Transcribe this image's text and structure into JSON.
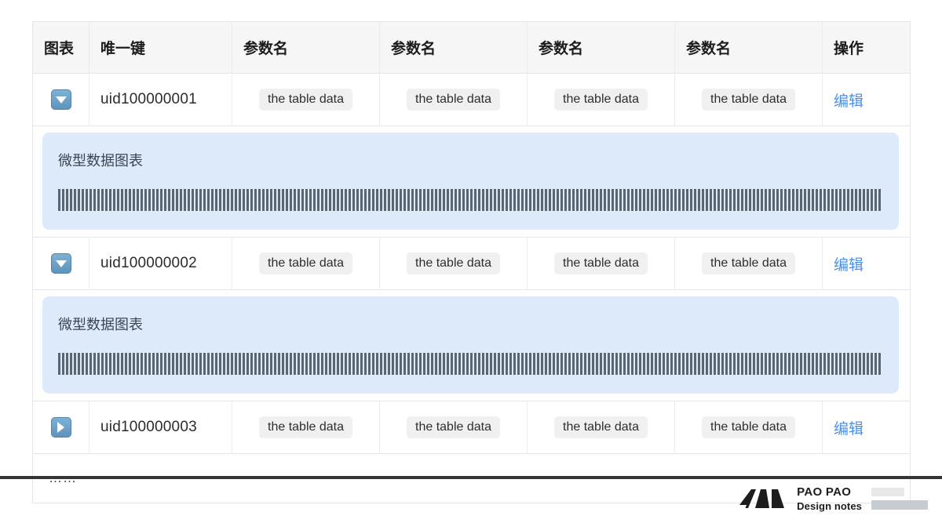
{
  "table": {
    "columns": [
      {
        "key": "chart",
        "label": "图表"
      },
      {
        "key": "uid",
        "label": "唯一键"
      },
      {
        "key": "p1",
        "label": "参数名"
      },
      {
        "key": "p2",
        "label": "参数名"
      },
      {
        "key": "p3",
        "label": "参数名"
      },
      {
        "key": "p4",
        "label": "参数名"
      },
      {
        "key": "op",
        "label": "操作"
      }
    ],
    "rows": [
      {
        "toggle_icon": "triangle-down-icon",
        "expanded": true,
        "uid": "uid100000001",
        "cells": [
          "the table data",
          "the table data",
          "the table data",
          "the table data"
        ],
        "action_label": "编辑",
        "panel": {
          "title": "微型数据图表",
          "chart_data": {
            "type": "bar",
            "title": "微型数据图表",
            "categories": [],
            "values": [
              28,
              28,
              28,
              28,
              28,
              28,
              28,
              28,
              28,
              28,
              28,
              28,
              28,
              28,
              28,
              28,
              28,
              28,
              28,
              28,
              28,
              28,
              28,
              28,
              28,
              28,
              28,
              28,
              28,
              28,
              28,
              28,
              28,
              28,
              28,
              28,
              28,
              28,
              28,
              28,
              28,
              28,
              28,
              28,
              28,
              28,
              28,
              28,
              28,
              28,
              28,
              28,
              28,
              28,
              28,
              28,
              28,
              28,
              28,
              28,
              28,
              28,
              28,
              28,
              28,
              28,
              28,
              28,
              28,
              28,
              28,
              28,
              28,
              28,
              28,
              28,
              28,
              28,
              28,
              28,
              28,
              28,
              28,
              28,
              28,
              28,
              28,
              28,
              28,
              28,
              28,
              28,
              28,
              28,
              28,
              28,
              28,
              28,
              28,
              28,
              28,
              28,
              28,
              28,
              28,
              28,
              28,
              28,
              28,
              28,
              28,
              28,
              28,
              28,
              28,
              28,
              28,
              28,
              28,
              28,
              28,
              28,
              28,
              28,
              28,
              28,
              28,
              28,
              28,
              28,
              28,
              28,
              28,
              28,
              28,
              28,
              28,
              28,
              28,
              28,
              28,
              28,
              28,
              28,
              28,
              28,
              28,
              28,
              28,
              28,
              28,
              28,
              28,
              28,
              28,
              28,
              28,
              28,
              28,
              28,
              28,
              28,
              28,
              28,
              28,
              28,
              28,
              28,
              28,
              28,
              28,
              28,
              28,
              28,
              28,
              28,
              28,
              28,
              28,
              28,
              28,
              28,
              28,
              28,
              28,
              28,
              28,
              28,
              28,
              28,
              28,
              28,
              28,
              28,
              28,
              28,
              28,
              28,
              28,
              28,
              28,
              28,
              28,
              28,
              28,
              28,
              28,
              28,
              28,
              28
            ],
            "xlabel": "",
            "ylabel": "",
            "grid": false,
            "legend": "none",
            "bar_color": "#5b6670"
          }
        }
      },
      {
        "toggle_icon": "triangle-down-icon",
        "expanded": true,
        "uid": "uid100000002",
        "cells": [
          "the table data",
          "the table data",
          "the table data",
          "the table data"
        ],
        "action_label": "编辑",
        "panel": {
          "title": "微型数据图表",
          "chart_data": {
            "type": "bar",
            "title": "微型数据图表",
            "categories": [],
            "values": [
              28,
              28,
              28,
              28,
              28,
              28,
              28,
              28,
              28,
              28,
              28,
              28,
              28,
              28,
              28,
              28,
              28,
              28,
              28,
              28,
              28,
              28,
              28,
              28,
              28,
              28,
              28,
              28,
              28,
              28,
              28,
              28,
              28,
              28,
              28,
              28,
              28,
              28,
              28,
              28,
              28,
              28,
              28,
              28,
              28,
              28,
              28,
              28,
              28,
              28,
              28,
              28,
              28,
              28,
              28,
              28,
              28,
              28,
              28,
              28,
              28,
              28,
              28,
              28,
              28,
              28,
              28,
              28,
              28,
              28,
              28,
              28,
              28,
              28,
              28,
              28,
              28,
              28,
              28,
              28,
              28,
              28,
              28,
              28,
              28,
              28,
              28,
              28,
              28,
              28,
              28,
              28,
              28,
              28,
              28,
              28,
              28,
              28,
              28,
              28,
              28,
              28,
              28,
              28,
              28,
              28,
              28,
              28,
              28,
              28,
              28,
              28,
              28,
              28,
              28,
              28,
              28,
              28,
              28,
              28,
              28,
              28,
              28,
              28,
              28,
              28,
              28,
              28,
              28,
              28,
              28,
              28,
              28,
              28,
              28,
              28,
              28,
              28,
              28,
              28,
              28,
              28,
              28,
              28,
              28,
              28,
              28,
              28,
              28,
              28,
              28,
              28,
              28,
              28,
              28,
              28,
              28,
              28,
              28,
              28,
              28,
              28,
              28,
              28,
              28,
              28,
              28,
              28,
              28,
              28,
              28,
              28,
              28,
              28,
              28,
              28,
              28,
              28,
              28,
              28,
              28,
              28,
              28,
              28,
              28,
              28,
              28,
              28,
              28,
              28,
              28,
              28,
              28,
              28,
              28,
              28,
              28,
              28,
              28,
              28,
              28,
              28,
              28,
              28,
              28,
              28,
              28,
              28,
              28,
              28
            ],
            "xlabel": "",
            "ylabel": "",
            "grid": false,
            "legend": "none",
            "bar_color": "#5b6670"
          }
        }
      },
      {
        "toggle_icon": "triangle-right-icon",
        "expanded": false,
        "uid": "uid100000003",
        "cells": [
          "the table data",
          "the table data",
          "the table data",
          "the table data"
        ],
        "action_label": "编辑",
        "panel": null
      }
    ],
    "more_indicator": "……"
  },
  "footer": {
    "logo_mark": "paopao-logo-mark",
    "brand_name": "PAO PAO",
    "brand_tagline": "Design notes"
  },
  "colors": {
    "link": "#4a90e8",
    "panel_bg": "#ddeafa",
    "header_bg": "#f6f6f6",
    "bar": "#5b6670",
    "toggle": "#5e93bd"
  }
}
